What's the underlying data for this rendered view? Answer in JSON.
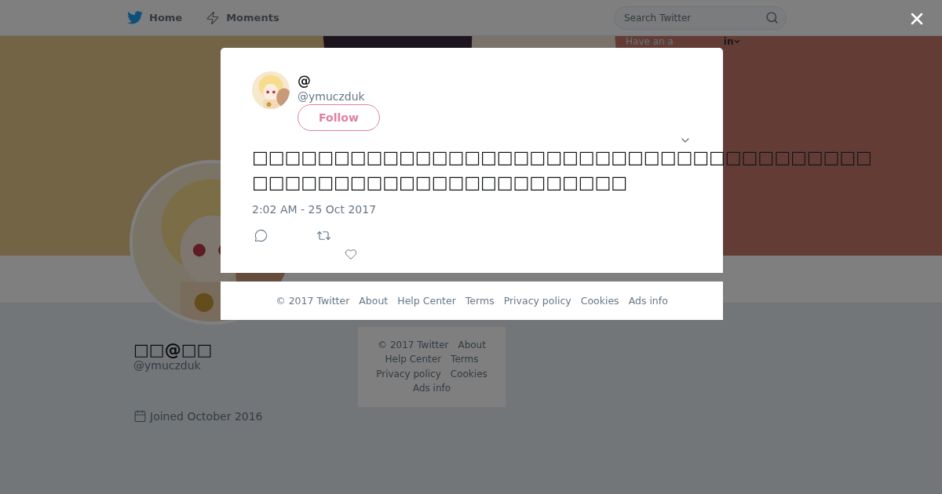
{
  "nav": {
    "items": [
      {
        "label": "Home"
      },
      {
        "label": "Moments"
      }
    ],
    "search": {
      "placeholder": "Search Twitter"
    },
    "login": {
      "prompt": "Have an a",
      "link": "in"
    }
  },
  "profile": {
    "name": "□□@□□",
    "handle": "@ymuczduk",
    "joined": "Joined October 2016"
  },
  "side_footer": [
    "© 2017 Twitter",
    "About",
    "Help Center",
    "Terms",
    "Privacy policy",
    "Cookies",
    "Ads info"
  ],
  "tweet": {
    "name": "@",
    "handle": "@ymuczduk",
    "follow": "Follow",
    "text": "□□□□□□□□□□□□□□□□□□□□□□□□□□□□□□□□□□□□□□□□□□□□□□□□□□□□□□□□□□□□□",
    "time": "2:02 AM - 25 Oct 2017"
  },
  "modal_footer": [
    "© 2017 Twitter",
    "About",
    "Help Center",
    "Terms",
    "Privacy policy",
    "Cookies",
    "Ads info"
  ]
}
